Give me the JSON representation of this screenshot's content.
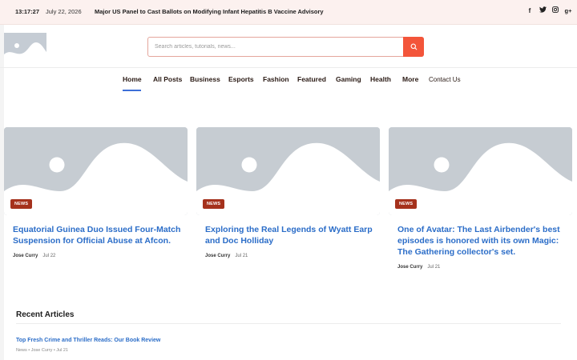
{
  "topbar": {
    "time": "13:17:27",
    "date": "July 22, 2026",
    "ticker": "Major US Panel to Cast Ballots on Modifying Infant Hepatitis B Vaccine Advisory",
    "social": [
      "f",
      "t",
      "ig",
      "g+"
    ]
  },
  "header": {
    "search_placeholder": "Search articles, tutorials, news..."
  },
  "nav": {
    "items": [
      "Home",
      "All Posts",
      "Business",
      "Esports",
      "Fashion",
      "Featured",
      "Gaming",
      "Health",
      "More",
      "Contact Us"
    ]
  },
  "cards": [
    {
      "badge": "NEWS",
      "title": "Equatorial Guinea Duo Issued Four-Match Suspension for Official Abuse at Afcon.",
      "author": "Jose Curry",
      "date": "Jul 22"
    },
    {
      "badge": "NEWS",
      "title": "Exploring the Real Legends of Wyatt Earp and Doc Holliday",
      "author": "Jose Curry",
      "date": "Jul 21"
    },
    {
      "badge": "NEWS",
      "title": "One of Avatar: The Last Airbender's best episodes is honored with its own Magic: The Gathering collector's set.",
      "author": "Jose Curry",
      "date": "Jul 21"
    }
  ],
  "recent": {
    "heading": "Recent Articles",
    "items": [
      {
        "title": "Top Fresh Crime and Thriller Reads: Our Book Review",
        "meta": "News • Jose Curry • Jul 21"
      }
    ]
  },
  "colors": {
    "accent": "#f3553a",
    "link": "#2b6dc8",
    "badge": "#a5311c",
    "nav_active": "#3c6fd8",
    "topbar_bg": "#fcf1ef"
  }
}
